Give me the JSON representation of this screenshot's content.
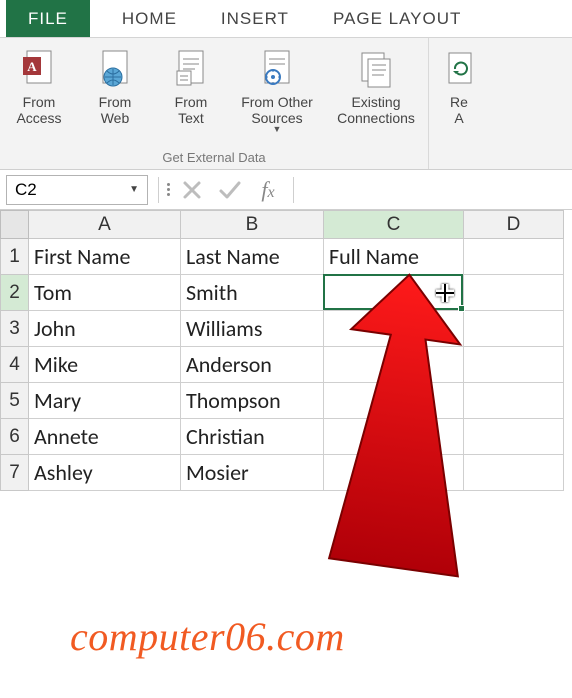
{
  "tabs": {
    "file": "FILE",
    "home": "HOME",
    "insert": "INSERT",
    "pageLayout": "PAGE LAYOUT"
  },
  "ribbon": {
    "groupLabel": "Get External Data",
    "buttons": {
      "fromAccess": "From\nAccess",
      "fromWeb": "From\nWeb",
      "fromText": "From\nText",
      "fromOther": "From Other\nSources",
      "existingConn": "Existing\nConnections",
      "refresh": "Re\nA"
    }
  },
  "formulaBar": {
    "nameBox": "C2",
    "formulaValue": ""
  },
  "grid": {
    "columns": [
      "A",
      "B",
      "C",
      "D"
    ],
    "rows": [
      {
        "num": "1",
        "A": "First Name",
        "B": "Last Name",
        "C": "Full Name",
        "D": ""
      },
      {
        "num": "2",
        "A": "Tom",
        "B": "Smith",
        "C": "",
        "D": ""
      },
      {
        "num": "3",
        "A": "John",
        "B": "Williams",
        "C": "",
        "D": ""
      },
      {
        "num": "4",
        "A": "Mike",
        "B": "Anderson",
        "C": "",
        "D": ""
      },
      {
        "num": "5",
        "A": "Mary",
        "B": "Thompson",
        "C": "",
        "D": ""
      },
      {
        "num": "6",
        "A": "Annete",
        "B": "Christian",
        "C": "",
        "D": ""
      },
      {
        "num": "7",
        "A": "Ashley",
        "B": "Mosier",
        "C": "",
        "D": ""
      }
    ],
    "selectedCell": "C2"
  },
  "watermark": "computer06.com",
  "colors": {
    "excelGreen": "#217346",
    "arrowRed": "#e30613",
    "brandOrange": "#f15a22"
  }
}
